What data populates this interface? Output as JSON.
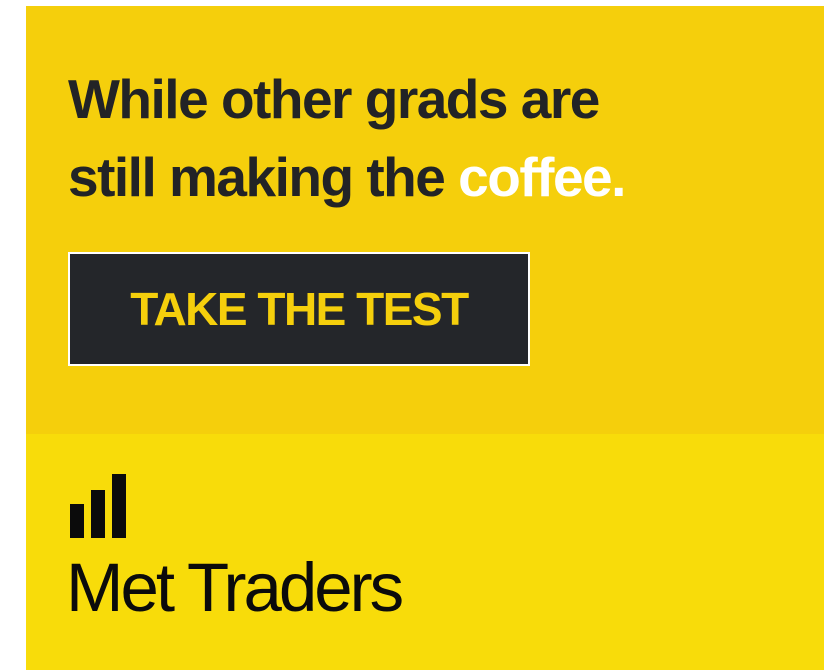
{
  "ad": {
    "headline": {
      "line1": "While other grads are",
      "line2_prefix": "still making the ",
      "line2_highlight": "coffee."
    },
    "cta_label": "TAKE THE TEST",
    "brand_name": "Met Traders",
    "logo_icon": "bar-chart-icon",
    "colors": {
      "top_background": "#f5cf0c",
      "bottom_background": "#f8dc0a",
      "headline_text": "#222326",
      "highlight_text": "#ffffff",
      "button_background": "#24262a",
      "button_text": "#f5cf0c",
      "brand_text": "#0b0b0b"
    }
  }
}
